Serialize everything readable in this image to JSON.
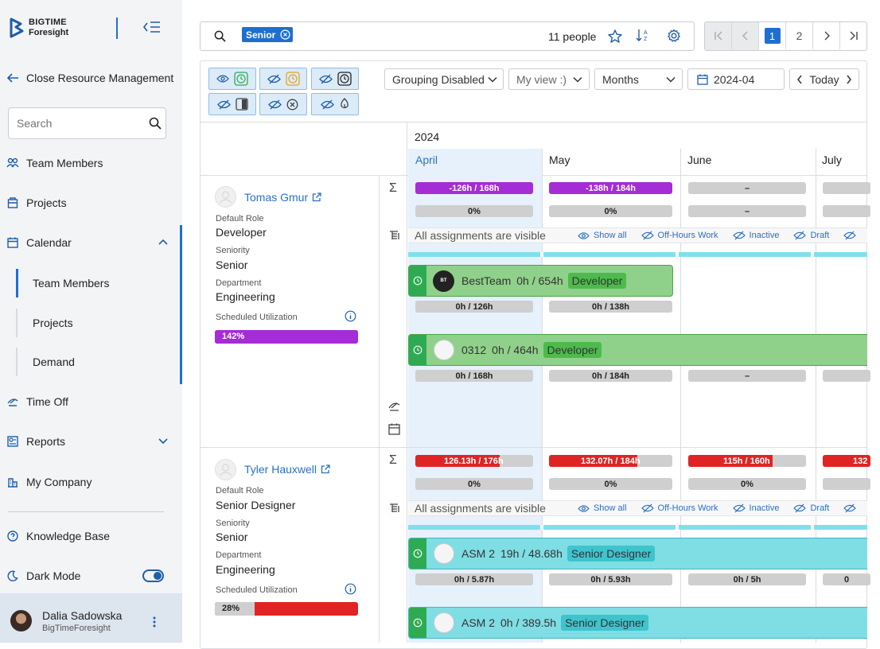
{
  "brand": {
    "line1": "BIGTIME",
    "line2": "Foresight"
  },
  "sidebar": {
    "close_label": "Close Resource Management",
    "search_placeholder": "Search",
    "items": [
      {
        "label": "Team Members",
        "icon": "team-icon"
      },
      {
        "label": "Projects",
        "icon": "projects-icon"
      },
      {
        "label": "Calendar",
        "icon": "calendar-icon"
      },
      {
        "label": "Time Off",
        "icon": "time-off-icon"
      },
      {
        "label": "Reports",
        "icon": "reports-icon"
      },
      {
        "label": "My Company",
        "icon": "company-icon"
      }
    ],
    "calendar_sub": [
      "Team Members",
      "Projects",
      "Demand"
    ],
    "knowledge_base": "Knowledge Base",
    "dark_mode": "Dark Mode",
    "user": {
      "name": "Dalia Sadowska",
      "org": "BigTimeForesight"
    }
  },
  "topbar": {
    "filter_chip": "Senior",
    "people_count": "11 people",
    "pages": [
      "1",
      "2"
    ]
  },
  "toolbar": {
    "grouping": "Grouping Disabled",
    "view": "My view :)",
    "period": "Months",
    "date": "2024-04",
    "today": "Today"
  },
  "calendar": {
    "year": "2024",
    "months": [
      "April",
      "May",
      "June",
      "July"
    ],
    "visibility": {
      "status": "All assignments are visible",
      "show_all": "Show all",
      "off_hours": "Off-Hours Work",
      "inactive": "Inactive",
      "draft": "Draft"
    }
  },
  "people": [
    {
      "name": "Tomas Gmur",
      "role_label": "Default Role",
      "role": "Developer",
      "seniority_label": "Seniority",
      "seniority": "Senior",
      "dept_label": "Department",
      "dept": "Engineering",
      "util_label": "Scheduled Utilization",
      "util": "142%",
      "util_pct": 1.42,
      "totals": [
        "-126h / 168h",
        "-138h / 184h",
        "–",
        ""
      ],
      "pct": [
        "0%",
        "0%",
        "–",
        ""
      ],
      "assignments": [
        {
          "name": "BestTeam",
          "hours": "0h / 654h",
          "role": "Developer",
          "sub": [
            "0h / 126h",
            "0h / 138h"
          ]
        },
        {
          "name": "0312",
          "hours": "0h / 464h",
          "role": "Developer",
          "sub": [
            "0h / 168h",
            "0h / 184h",
            "–",
            ""
          ]
        }
      ]
    },
    {
      "name": "Tyler Hauxwell",
      "role_label": "Default Role",
      "role": "Senior Designer",
      "seniority_label": "Seniority",
      "seniority": "Senior",
      "dept_label": "Department",
      "dept": "Engineering",
      "util_label": "Scheduled Utilization",
      "util": "28%",
      "util_pct": 0.28,
      "totals": [
        "126.13h / 176h",
        "132.07h / 184h",
        "115h / 160h",
        "132"
      ],
      "pct": [
        "0%",
        "0%",
        "0%",
        ""
      ],
      "assignments": [
        {
          "name": "ASM 2",
          "hours": "19h / 48.68h",
          "role": "Senior Designer",
          "sub": [
            "0h / 5.87h",
            "0h / 5.93h",
            "0h / 5h",
            "0"
          ]
        },
        {
          "name": "ASM 2",
          "hours": "0h / 389.5h",
          "role": "Senior Designer",
          "sub": []
        }
      ]
    }
  ]
}
